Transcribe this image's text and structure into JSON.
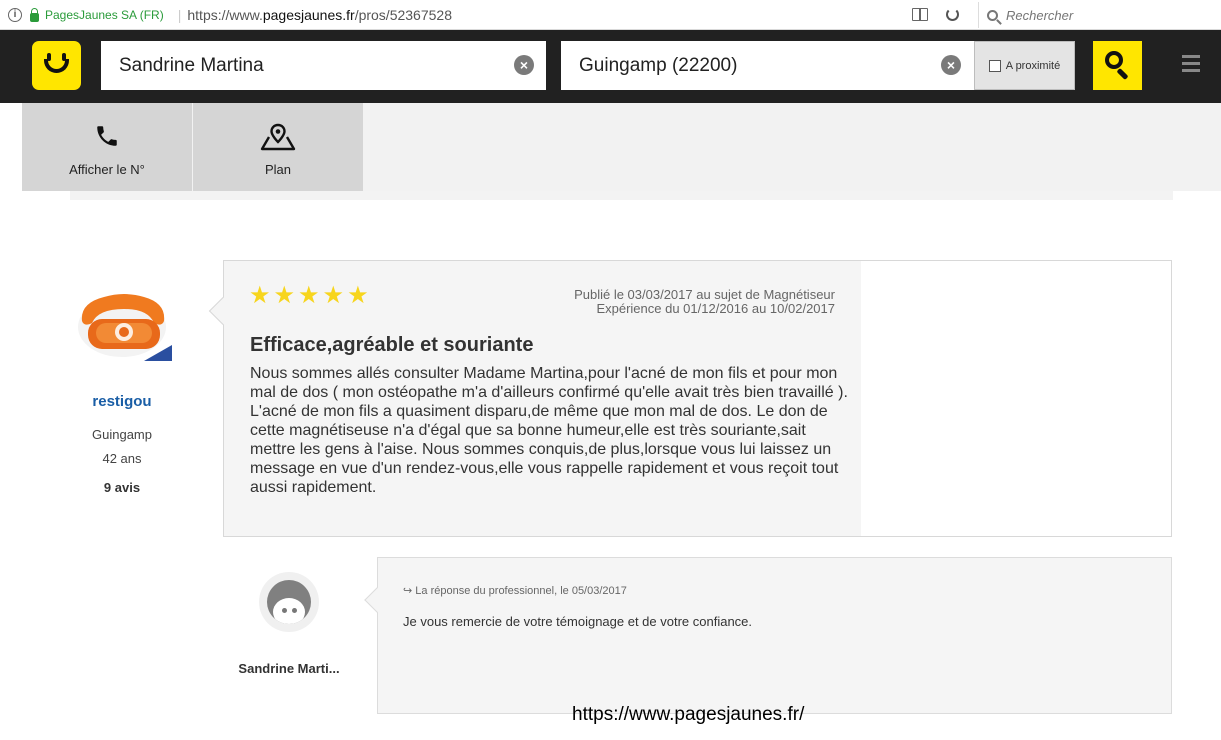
{
  "browser": {
    "site_identity": "PagesJaunes SA (FR)",
    "url_prefix": "https://www.",
    "url_domain": "pagesjaunes.fr",
    "url_path": "/pros/52367528",
    "search_placeholder": "Rechercher"
  },
  "header": {
    "query_value": "Sandrine Martina",
    "location_value": "Guingamp (22200)",
    "nearby_label": "A proximité",
    "accent_color": "#ffe600",
    "bar_color": "#212121"
  },
  "actions": {
    "phone_label": "Afficher le N°",
    "map_label": "Plan"
  },
  "review": {
    "author": "restigou",
    "city": "Guingamp",
    "age": "42 ans",
    "review_count": "9 avis",
    "rating": 5,
    "published": "Publié le 03/03/2017 au sujet de Magnétiseur",
    "experience": "Expérience du 01/12/2016 au 10/02/2017",
    "title": "Efficace,agréable et souriante",
    "body": "Nous sommes allés consulter Madame Martina,pour l'acné de mon fils et pour mon mal de dos ( mon ostéopathe m'a d'ailleurs confirmé qu'elle avait très bien travaillé ). L'acné de mon fils a quasiment disparu,de même que mon mal de dos. Le don de cette magnétiseuse n'a d'égal que sa bonne humeur,elle est très souriante,sait mettre les gens à l'aise. Nous sommes conquis,de plus,lorsque vous lui laissez un message en vue d'un rendez-vous,elle vous rappelle rapidement et vous reçoit tout aussi rapidement."
  },
  "reply": {
    "professional_name": "Sandrine Marti...",
    "meta": "↪ La réponse du professionnel, le 05/03/2017",
    "text": "Je vous remercie de votre témoignage et de votre confiance."
  },
  "watermark": "https://www.pagesjaunes.fr/"
}
